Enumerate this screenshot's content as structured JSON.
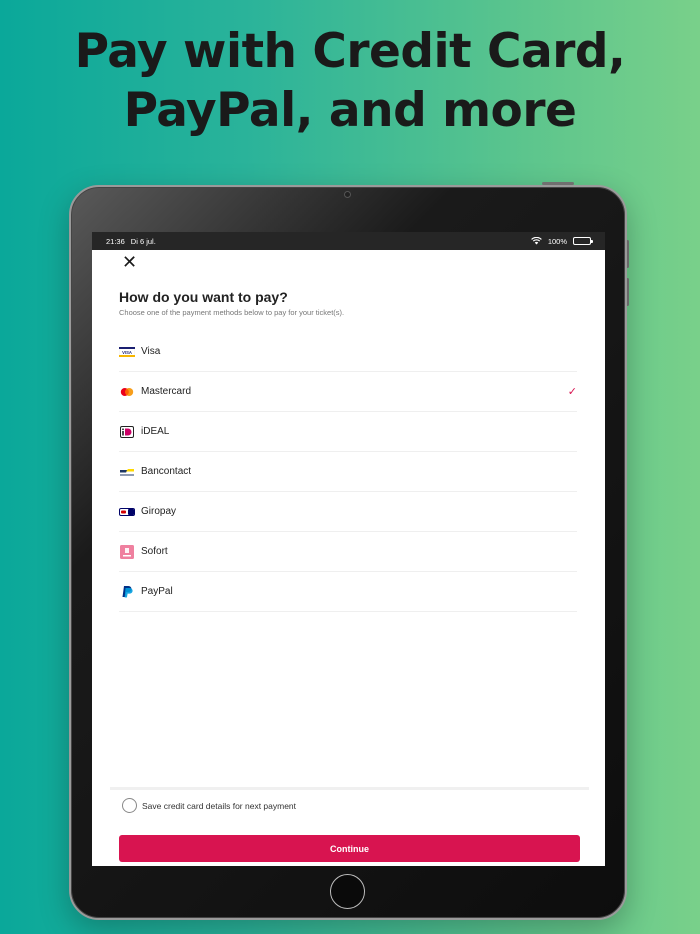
{
  "headline": {
    "line1": "Pay with Credit Card,",
    "line2": "PayPal, and more"
  },
  "status_bar": {
    "time": "21:36",
    "date": "Di 6 jul.",
    "battery": "100%",
    "battery_level": 1.0
  },
  "page": {
    "title": "How do you want to pay?",
    "subtitle": "Choose one of the payment methods below to pay for your ticket(s)."
  },
  "methods": [
    {
      "label": "Visa",
      "icon": "visa-icon",
      "selected": false
    },
    {
      "label": "Mastercard",
      "icon": "mastercard-icon",
      "selected": true
    },
    {
      "label": "iDEAL",
      "icon": "ideal-icon",
      "selected": false
    },
    {
      "label": "Bancontact",
      "icon": "bancontact-icon",
      "selected": false
    },
    {
      "label": "Giropay",
      "icon": "giropay-icon",
      "selected": false
    },
    {
      "label": "Sofort",
      "icon": "sofort-icon",
      "selected": false
    },
    {
      "label": "PayPal",
      "icon": "paypal-icon",
      "selected": false
    }
  ],
  "save_option": {
    "label": "Save credit card details for next payment",
    "checked": false
  },
  "continue_label": "Continue",
  "colors": {
    "accent": "#d81450",
    "background_start": "#0aa89a",
    "background_end": "#79d08a"
  }
}
